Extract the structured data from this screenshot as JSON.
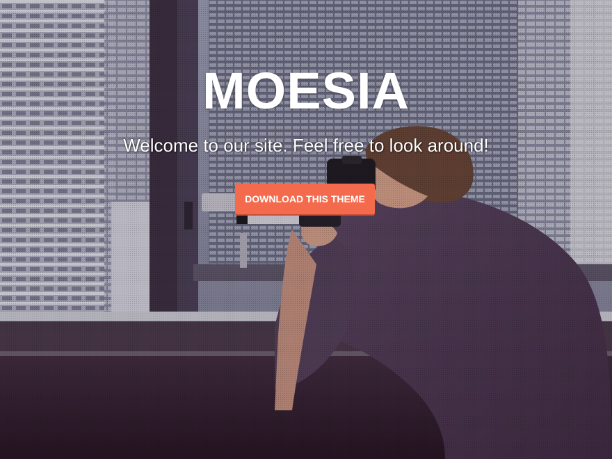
{
  "hero": {
    "site_title": "MOESIA",
    "tagline": "Welcome to our site. Feel free to look around!",
    "cta_label": "DOWNLOAD THIS THEME"
  },
  "colors": {
    "accent": "#f46a4d",
    "text": "#ffffff"
  }
}
